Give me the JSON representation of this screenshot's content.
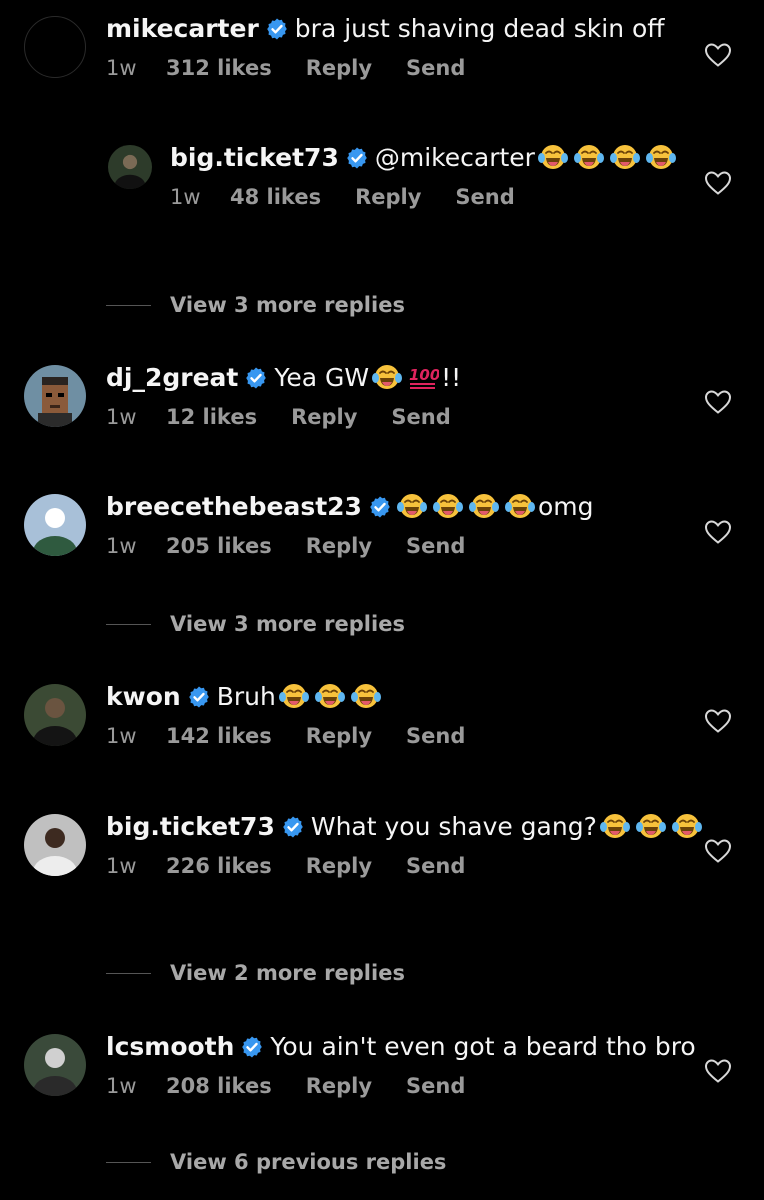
{
  "colors": {
    "background": "#000000",
    "text": "#f5f5f5",
    "muted": "#9a9a9a",
    "verified": "#3897f0"
  },
  "comments": [
    {
      "username": "mikecarter",
      "verified": true,
      "text": "bra just shaving dead skin off",
      "emojis": [],
      "time": "1w",
      "likes": "312 likes",
      "reply": "Reply",
      "send": "Send",
      "liked": false,
      "avatar": "empty"
    },
    {
      "username": "big.ticket73",
      "verified": true,
      "text": "@mikecarter",
      "emojis": [
        "face-with-tears-of-joy",
        "face-with-tears-of-joy",
        "face-with-tears-of-joy",
        "face-with-tears-of-joy"
      ],
      "time": "1w",
      "likes": "48 likes",
      "reply": "Reply",
      "send": "Send",
      "liked": false,
      "avatar": "photo"
    },
    {
      "username": "dj_2great",
      "verified": true,
      "text": "Yea GW",
      "emojis": [
        "face-with-tears-of-joy",
        "hundred-points"
      ],
      "suffix": "!!",
      "time": "1w",
      "likes": "12 likes",
      "reply": "Reply",
      "send": "Send",
      "liked": false,
      "avatar": "pixel-art"
    },
    {
      "username": "breecethebeast23",
      "verified": true,
      "text": "",
      "emojis": [
        "face-with-tears-of-joy",
        "face-with-tears-of-joy",
        "face-with-tears-of-joy",
        "face-with-tears-of-joy"
      ],
      "suffix": "omg",
      "time": "1w",
      "likes": "205 likes",
      "reply": "Reply",
      "send": "Send",
      "liked": false,
      "avatar": "photo"
    },
    {
      "username": "kwon",
      "verified": true,
      "text": "Bruh",
      "emojis": [
        "face-with-tears-of-joy",
        "face-with-tears-of-joy",
        "face-with-tears-of-joy"
      ],
      "time": "1w",
      "likes": "142 likes",
      "reply": "Reply",
      "send": "Send",
      "liked": false,
      "avatar": "photo"
    },
    {
      "username": "big.ticket73",
      "verified": true,
      "text": "What you shave gang?",
      "emojis": [
        "face-with-tears-of-joy",
        "face-with-tears-of-joy",
        "face-with-tears-of-joy"
      ],
      "time": "1w",
      "likes": "226 likes",
      "reply": "Reply",
      "send": "Send",
      "liked": false,
      "avatar": "photo"
    },
    {
      "username": "lcsmooth",
      "verified": true,
      "text": "You ain't even got a beard tho bro",
      "emojis": [],
      "time": "1w",
      "likes": "208 likes",
      "reply": "Reply",
      "send": "Send",
      "liked": false,
      "avatar": "photo"
    }
  ],
  "view_more": [
    {
      "label": "View 3 more replies"
    },
    {
      "label": "View 3 more replies"
    },
    {
      "label": "View 2 more replies"
    },
    {
      "label": "View 6 previous replies"
    }
  ]
}
